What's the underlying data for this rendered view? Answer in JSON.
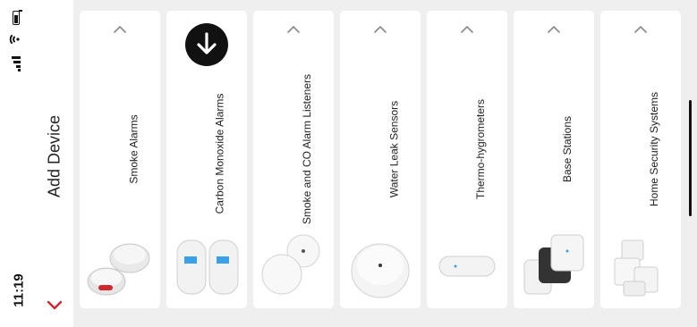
{
  "status": {
    "time": "11:19"
  },
  "header": {
    "title": "Add Device"
  },
  "devices": [
    {
      "label": "Smoke Alarms",
      "control": "chevron"
    },
    {
      "label": "Carbon Monoxide Alarms",
      "control": "download"
    },
    {
      "label": "Smoke and CO Alarm Listeners",
      "control": "chevron"
    },
    {
      "label": "Water Leak Sensors",
      "control": "chevron"
    },
    {
      "label": "Thermo-hygrometers",
      "control": "chevron"
    },
    {
      "label": "Base Stations",
      "control": "chevron"
    },
    {
      "label": "Home Security Systems",
      "control": "chevron"
    }
  ],
  "icons": [
    "battery-icon",
    "wifi-icon",
    "signal-icon",
    "back-chevron-icon",
    "chevron-up-icon",
    "download-arrow-icon"
  ],
  "colors": {
    "accent_red": "#d0262d",
    "card_bg": "#ffffff",
    "page_bg": "#efefef",
    "download_bg": "#111111"
  }
}
